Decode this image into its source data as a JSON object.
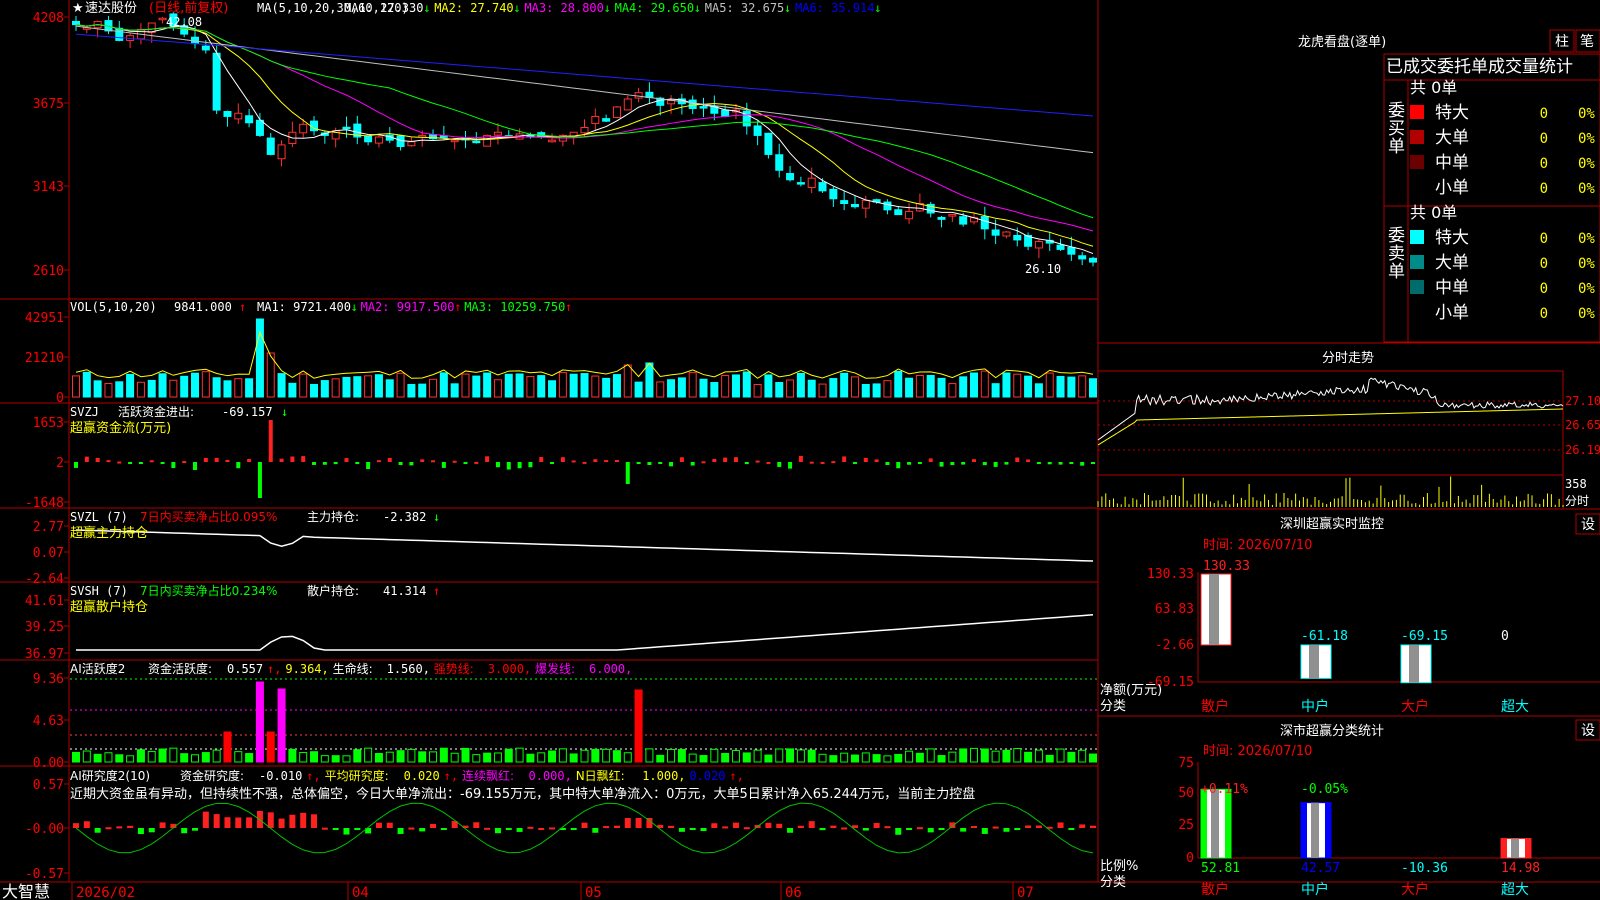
{
  "stock": {
    "name": "速达股份",
    "period": "(日线,前复权)",
    "marker": "★"
  },
  "main": {
    "ma_title": "MA(5,10,20,30,60,120)",
    "ma": [
      {
        "label": "MA1:",
        "value": "27.330",
        "arrow": "↓",
        "color": "#ffffff"
      },
      {
        "label": "MA2:",
        "value": "27.740",
        "arrow": "↓",
        "color": "#ffff00"
      },
      {
        "label": "MA3:",
        "value": "28.800",
        "arrow": "↓",
        "color": "#ff00ff"
      },
      {
        "label": "MA4:",
        "value": "29.650",
        "arrow": "↓",
        "color": "#00ff00"
      },
      {
        "label": "MA5:",
        "value": "32.675",
        "arrow": "↓",
        "color": "#c0c0c0"
      },
      {
        "label": "MA6:",
        "value": "35.914",
        "arrow": "↓",
        "color": "#0000ff"
      }
    ],
    "yticks": [
      "4208",
      "3675",
      "3143",
      "2610"
    ],
    "high_label": "42.08",
    "low_label": "26.10"
  },
  "vol": {
    "title": "VOL(5,10,20)",
    "value": "9841.000",
    "arrow": "↑",
    "ma": [
      {
        "label": "MA1:",
        "value": "9721.400",
        "arrow": "↓",
        "color": "#ffffff"
      },
      {
        "label": "MA2:",
        "value": "9917.500",
        "arrow": "↑",
        "color": "#ff00ff"
      },
      {
        "label": "MA3:",
        "value": "10259.750",
        "arrow": "↑",
        "color": "#00ff00"
      }
    ],
    "yticks": [
      "42951",
      "21210",
      "0"
    ]
  },
  "svzj": {
    "title": "SVZJ",
    "desc": "活跃资金进出:",
    "value": "-69.157",
    "arrow": "↓",
    "sub": "超赢资金流(万元)",
    "yticks": [
      "1653",
      "2",
      "-1648"
    ]
  },
  "svzl": {
    "title": "SVZL (7)",
    "desc": "7日内买卖净占比0.095%",
    "label": "主力持仓:",
    "value": "-2.382",
    "arrow": "↓",
    "sub": "超赢主力持仓",
    "yticks": [
      "2.77",
      "0.07",
      "-2.64"
    ]
  },
  "svsh": {
    "title": "SVSH (7)",
    "desc": "7日内买卖净占比0.234%",
    "label": "散户持仓:",
    "value": "41.314",
    "arrow": "↑",
    "sub": "超赢散户持仓",
    "yticks": [
      "41.61",
      "39.25",
      "36.97"
    ]
  },
  "ai": {
    "title": "AI活跃度2",
    "items": [
      {
        "text": "资金活跃度:",
        "color": "#ffffff"
      },
      {
        "text": "0.557",
        "color": "#ffffff"
      },
      {
        "text": "↑,",
        "color": "#ff0000"
      },
      {
        "text": "9.364,",
        "color": "#ffff00"
      },
      {
        "text": "生命线:",
        "color": "#ffffff"
      },
      {
        "text": "1.560,",
        "color": "#ffffff"
      },
      {
        "text": "强势线:",
        "color": "#ff0000"
      },
      {
        "text": "3.000,",
        "color": "#ff0000"
      },
      {
        "text": "爆发线:",
        "color": "#ff00ff"
      },
      {
        "text": "6.000,",
        "color": "#ff00ff"
      }
    ],
    "yticks": [
      "9.36",
      "4.63",
      "0.00"
    ]
  },
  "research": {
    "title": "AI研究度2(10)",
    "items": [
      {
        "text": "资金研究度:",
        "color": "#ffffff"
      },
      {
        "text": "-0.010",
        "color": "#ffffff"
      },
      {
        "text": "↑,",
        "color": "#ff0000"
      },
      {
        "text": "平均研究度:",
        "color": "#ffff00"
      },
      {
        "text": "0.020",
        "color": "#ffff00"
      },
      {
        "text": "↑,",
        "color": "#ff0000"
      },
      {
        "text": "连续飘红:",
        "color": "#ff00ff"
      },
      {
        "text": "0.000,",
        "color": "#ff00ff"
      },
      {
        "text": "N日飘红:",
        "color": "#ffff00"
      },
      {
        "text": "1.000,",
        "color": "#ffff00"
      },
      {
        "text": "0.020",
        "color": "#0000ff"
      },
      {
        "text": "↑,",
        "color": "#ff0000"
      }
    ],
    "comment": "近期大资金虽有异动，但持续性不强，总体偏空，今日大单净流出：-69.155万元，其中特大单净流入：0万元，大单5日累计净入65.244万元，当前主力控盘",
    "yticks": [
      "0.57",
      "-0.00",
      "-0.57"
    ]
  },
  "xaxis": {
    "labels": [
      "2026/02",
      "04",
      "05",
      "06",
      "07"
    ],
    "brand": "大智慧"
  },
  "right": {
    "lhb_title": "龙虎看盘(逐单)",
    "tab_bar": "柱",
    "tab_pen": "笔",
    "table_title": "已成交委托单成交量统计",
    "buy": {
      "side": "委买单",
      "total": "共 0单",
      "rows": [
        {
          "name": "特大",
          "value": "0",
          "pct": "0%",
          "color": "#ff0000"
        },
        {
          "name": "大单",
          "value": "0",
          "pct": "0%",
          "color": "#b00000"
        },
        {
          "name": "中单",
          "value": "0",
          "pct": "0%",
          "color": "#6b0000"
        },
        {
          "name": "小单",
          "value": "0",
          "pct": "0%",
          "color": "#000000"
        }
      ]
    },
    "sell": {
      "side": "委卖单",
      "total": "共 0单",
      "rows": [
        {
          "name": "特大",
          "value": "0",
          "pct": "0%",
          "color": "#00ffff"
        },
        {
          "name": "大单",
          "value": "0",
          "pct": "0%",
          "color": "#008b8b"
        },
        {
          "name": "中单",
          "value": "0",
          "pct": "0%",
          "color": "#006b6b"
        },
        {
          "name": "小单",
          "value": "0",
          "pct": "0%",
          "color": "#000000"
        }
      ]
    },
    "intraday": {
      "title": "分时走势",
      "yticks": [
        "27.10",
        "26.65",
        "26.19"
      ],
      "vol_top": "358",
      "vol_unit": "分时"
    },
    "monitor": {
      "title": "深圳超赢实时监控",
      "set": "设",
      "time": "时间: 2026/07/10",
      "yticks": [
        "130.33",
        "63.83",
        "-2.66",
        "-69.15"
      ],
      "unit": "净额(万元)",
      "cat_label": "分类",
      "categories": [
        "散户",
        "中户",
        "大户",
        "超大"
      ],
      "values": [
        "130.33",
        "-61.18",
        "-69.15",
        "0"
      ]
    },
    "classify": {
      "title": "深市超赢分类统计",
      "set": "设",
      "time": "时间: 2026/07/10",
      "yticks": [
        "75",
        "50",
        "25",
        "0"
      ],
      "unit": "比例%",
      "cat_label": "分类",
      "categories": [
        "散户",
        "中户",
        "大户",
        "超大"
      ],
      "top_labels": [
        "+0.11%",
        "-0.05%",
        "",
        ""
      ],
      "values": [
        "52.81",
        "42.57",
        "-10.36",
        "14.98"
      ]
    }
  },
  "chart_data": {
    "type": "candlestick",
    "title": "速达股份 (日线,前复权)",
    "x_ticks": [
      "2026/02",
      "04",
      "05",
      "06",
      "07"
    ],
    "y_range": [
      26.1,
      42.08
    ],
    "ma_last": {
      "MA1": 27.33,
      "MA2": 27.74,
      "MA3": 28.8,
      "MA4": 29.65,
      "MA5": 32.675,
      "MA6": 35.914
    },
    "closes": [
      41.6,
      41.4,
      41.8,
      41.2,
      40.6,
      40.9,
      41.3,
      41.7,
      42.0,
      41.5,
      41.0,
      40.4,
      40.0,
      36.2,
      35.8,
      36.0,
      35.4,
      34.6,
      33.4,
      34.0,
      34.8,
      35.3,
      34.9,
      34.6,
      34.9,
      35.1,
      34.5,
      34.2,
      34.5,
      34.3,
      33.9,
      34.2,
      34.6,
      34.4,
      34.5,
      34.3,
      34.4,
      34.2,
      34.6,
      34.8,
      34.5,
      34.7,
      34.6,
      34.5,
      34.3,
      34.6,
      34.8,
      35.1,
      35.8,
      35.5,
      36.4,
      36.9,
      37.3,
      37.0,
      36.5,
      36.8,
      36.6,
      36.3,
      36.4,
      36.0,
      35.8,
      36.2,
      35.2,
      34.6,
      33.4,
      32.4,
      31.8,
      31.6,
      31.9,
      31.1,
      30.6,
      30.3,
      30.1,
      30.5,
      30.4,
      29.9,
      29.6,
      29.8,
      30.3,
      29.7,
      29.3,
      29.6,
      29.0,
      29.4,
      28.7,
      28.3,
      28.5,
      28.0,
      27.6,
      27.9,
      27.8,
      27.4,
      27.1,
      26.8,
      26.6
    ]
  }
}
